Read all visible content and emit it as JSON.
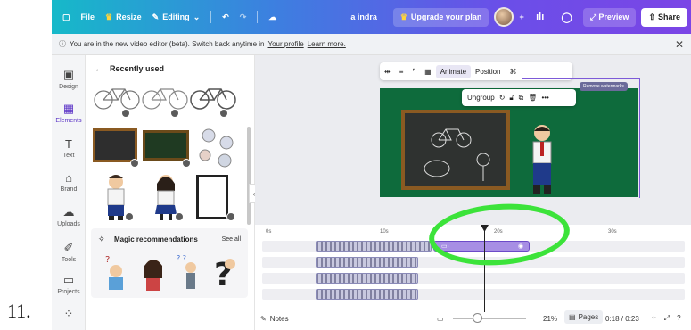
{
  "list_number": "11.",
  "topbar": {
    "file": "File",
    "resize": "Resize",
    "editing": "Editing",
    "user": "a indra",
    "upgrade": "Upgrade your plan",
    "preview": "Preview",
    "share": "Share"
  },
  "infobar": {
    "text_before": "You are in the new video editor (beta). Switch back anytime in",
    "profile_link": "Your profile",
    "learn_more": "Learn more."
  },
  "rail": {
    "items": [
      {
        "label": "Design",
        "icon": "design-icon"
      },
      {
        "label": "Elements",
        "icon": "elements-icon"
      },
      {
        "label": "Text",
        "icon": "text-icon"
      },
      {
        "label": "Brand",
        "icon": "brand-icon"
      },
      {
        "label": "Uploads",
        "icon": "uploads-icon"
      },
      {
        "label": "Tools",
        "icon": "tools-icon"
      },
      {
        "label": "Projects",
        "icon": "projects-icon"
      }
    ]
  },
  "panel": {
    "heading": "Recently used",
    "magic_title": "Magic recommendations",
    "see_all": "See all"
  },
  "canvas_toolbar": {
    "animate": "Animate",
    "position": "Position"
  },
  "float_menu": {
    "ungroup": "Ungroup"
  },
  "watermark": "Remove watermarks",
  "timeline": {
    "ticks": [
      "0s",
      "10s",
      "20s",
      "30s"
    ]
  },
  "bottom": {
    "notes": "Notes",
    "zoom": "21%",
    "pages": "Pages",
    "time": "0:18 / 0:23"
  },
  "colors": {
    "canvas_bg": "#0e6b3c",
    "accent": "#7d5ad8",
    "highlight_circle": "#3ce33a"
  }
}
